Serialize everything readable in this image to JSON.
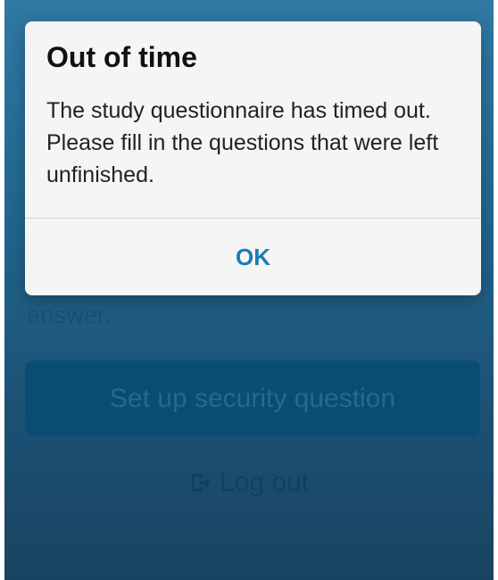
{
  "background": {
    "partial_text_top": "...",
    "partial_text": "answer.",
    "setup_button_label": "Set up security question",
    "logout_label": "Log out"
  },
  "dialog": {
    "title": "Out of time",
    "message": "The study questionnaire has timed out. Please fill in the questions that were left unfinished.",
    "ok_label": "OK"
  },
  "colors": {
    "accent": "#1b7bb5",
    "background_top": "#3a8fbf",
    "background_bottom": "#1f4e6f",
    "dialog_bg": "#f5f5f5"
  },
  "icons": {
    "logout": "logout-icon"
  }
}
